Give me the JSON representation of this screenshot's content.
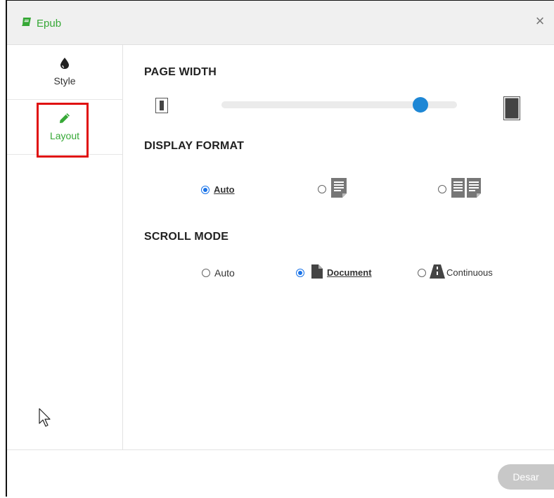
{
  "dialog": {
    "title": "Epub",
    "close_glyph": "×"
  },
  "sidebar": {
    "items": [
      {
        "label": "Style",
        "icon": "droplet-icon"
      },
      {
        "label": "Layout",
        "icon": "pencil-icon",
        "active": true
      }
    ]
  },
  "sections": {
    "page_width": {
      "title": "PAGE WIDTH",
      "slider_value_fraction": 0.87
    },
    "display_format": {
      "title": "DISPLAY FORMAT",
      "options": [
        {
          "label": "Auto",
          "selected": true
        },
        {
          "label": "",
          "icon": "single-page-icon",
          "selected": false
        },
        {
          "label": "",
          "icon": "two-page-icon",
          "selected": false
        }
      ]
    },
    "scroll_mode": {
      "title": "SCROLL MODE",
      "options": [
        {
          "label": "Auto",
          "selected": false
        },
        {
          "label": "Document",
          "icon": "document-icon",
          "selected": true
        },
        {
          "label": "Continuous",
          "icon": "road-icon",
          "selected": false
        }
      ]
    }
  },
  "footer": {
    "close_label": "Desar"
  },
  "colors": {
    "accent_green": "#36a836",
    "slider_blue": "#1e87d5",
    "highlight_red": "#e01010"
  }
}
